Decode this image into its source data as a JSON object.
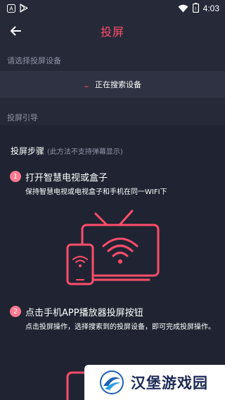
{
  "status_bar": {
    "time": "4:03",
    "left_icons": [
      "notification-a-icon",
      "play-store-icon"
    ],
    "right_icons": [
      "wifi-icon",
      "battery-icon"
    ]
  },
  "header": {
    "title": "投屏",
    "back_icon": "arrow-left-icon"
  },
  "select_section": {
    "label": "请选择投屏设备",
    "status_text": "正在搜索设备"
  },
  "guide": {
    "label": "投屏引导",
    "heading": "投屏步骤",
    "heading_note": "(此方法不支持弹幕显示)",
    "steps": [
      {
        "number": "1",
        "title": "打开智慧电视或盒子",
        "desc": "保持智慧电视或电视盒子和手机在同一WIFI下"
      },
      {
        "number": "2",
        "title": "点击手机APP播放器投屏按钮",
        "desc": "点击投屏操作，选择搜索到的投屏设备，即可完成投屏操作。"
      }
    ]
  },
  "watermark": {
    "text": "汉堡游戏园"
  },
  "colors": {
    "accent": "#ff4d6a",
    "background": "#262a38",
    "muted_text": "#8e93a6"
  }
}
